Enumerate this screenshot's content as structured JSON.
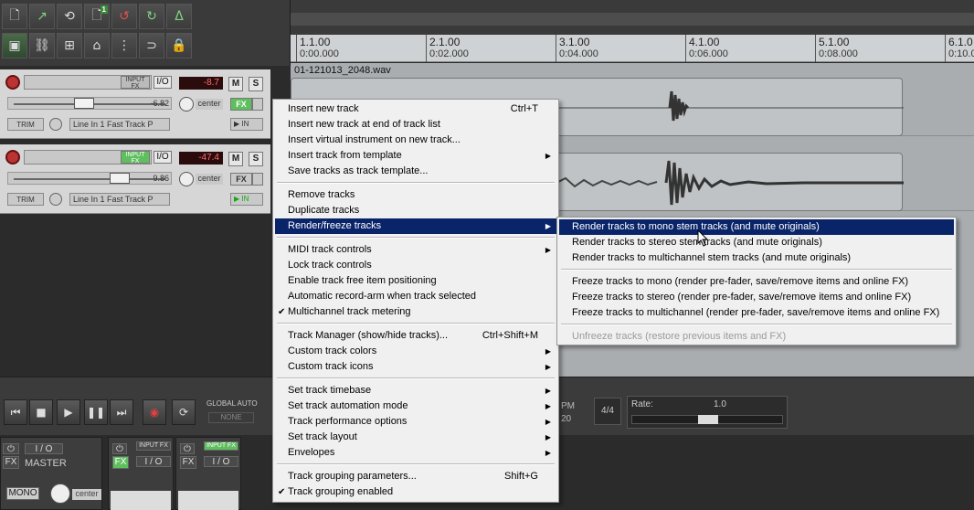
{
  "toolbar": {
    "icons": [
      "new-project-icon",
      "open-project-icon",
      "save-project-icon",
      "project-badge-icon",
      "undo-icon",
      "redo-icon",
      "metronome-icon",
      "grid-snap-icon",
      "ripple-edit-icon",
      "envelope-icon",
      "item-lock-icon",
      "loop-icon",
      "lock-icon"
    ],
    "badge": "1"
  },
  "tracks": [
    {
      "input_fx": "INPUT FX",
      "io": "I/O",
      "volume": "-8.7",
      "mute": "M",
      "solo": "S",
      "fader_value": "-6.82",
      "pan": "center",
      "fx": "FX",
      "trim": "TRIM",
      "rec_input": "Line In 1 Fast Track P",
      "monitor": "IN",
      "fader_fraction": 0.44,
      "fx_active": true,
      "input_fx_active": false,
      "monitor_active": false
    },
    {
      "input_fx": "INPUT FX",
      "io": "I/O",
      "volume": "-47.4",
      "mute": "M",
      "solo": "S",
      "fader_value": "9.86",
      "pan": "center",
      "fx": "FX",
      "trim": "TRIM",
      "rec_input": "Line In 1 Fast Track P",
      "monitor": "IN",
      "fader_fraction": 0.7,
      "fx_active": false,
      "input_fx_active": true,
      "monitor_active": true
    }
  ],
  "ruler": [
    {
      "bar": "1.1.00",
      "time": "0:00.000"
    },
    {
      "bar": "2.1.00",
      "time": "0:02.000"
    },
    {
      "bar": "3.1.00",
      "time": "0:04.000"
    },
    {
      "bar": "4.1.00",
      "time": "0:06.000"
    },
    {
      "bar": "5.1.00",
      "time": "0:08.000"
    },
    {
      "bar": "6.1.0",
      "time": "0:10.0"
    }
  ],
  "item_name": "01-121013_2048.wav",
  "transport": {
    "global_auto": "GLOBAL AUTO",
    "none": "NONE",
    "bpm": "PM",
    "bpm_value": "20",
    "time_sig": "4/4",
    "rate_label": "Rate:",
    "rate_value": "1.0"
  },
  "mixer": {
    "master_label": "MASTER",
    "io": "I / O",
    "fx": "FX",
    "mono": "MONO",
    "pan": "center",
    "input_fx": "INPUT FX"
  },
  "context_menu": {
    "items": [
      {
        "label": "Insert new track",
        "shortcut": "Ctrl+T"
      },
      {
        "label": "Insert new track at end of track list"
      },
      {
        "label": "Insert virtual instrument on new track..."
      },
      {
        "label": "Insert track from template",
        "submenu": true
      },
      {
        "label": "Save tracks as track template..."
      },
      {
        "sep": true
      },
      {
        "label": "Remove tracks"
      },
      {
        "label": "Duplicate tracks"
      },
      {
        "label": "Render/freeze tracks",
        "submenu": true,
        "highlighted": true
      },
      {
        "sep": true
      },
      {
        "label": "MIDI track controls",
        "submenu": true
      },
      {
        "label": "Lock track controls"
      },
      {
        "label": "Enable track free item positioning"
      },
      {
        "label": "Automatic record-arm when track selected"
      },
      {
        "label": "Multichannel track metering",
        "checked": true
      },
      {
        "sep": true
      },
      {
        "label": "Track Manager (show/hide tracks)...",
        "shortcut": "Ctrl+Shift+M"
      },
      {
        "label": "Custom track colors",
        "submenu": true
      },
      {
        "label": "Custom track icons",
        "submenu": true
      },
      {
        "sep": true
      },
      {
        "label": "Set track timebase",
        "submenu": true
      },
      {
        "label": "Set track automation mode",
        "submenu": true
      },
      {
        "label": "Track performance options",
        "submenu": true
      },
      {
        "label": "Set track layout",
        "submenu": true
      },
      {
        "label": "Envelopes",
        "submenu": true
      },
      {
        "sep": true
      },
      {
        "label": "Track grouping parameters...",
        "shortcut": "Shift+G"
      },
      {
        "label": "Track grouping enabled",
        "checked": true
      }
    ]
  },
  "submenu": {
    "items": [
      {
        "label": "Render tracks to mono stem tracks (and mute originals)",
        "highlighted": true
      },
      {
        "label": "Render tracks to stereo stem tracks (and mute originals)"
      },
      {
        "label": "Render tracks to multichannel stem tracks (and mute originals)"
      },
      {
        "sep": true
      },
      {
        "label": "Freeze tracks to mono (render pre-fader, save/remove items and online FX)"
      },
      {
        "label": "Freeze tracks to stereo (render pre-fader, save/remove items and online FX)"
      },
      {
        "label": "Freeze tracks to multichannel (render pre-fader, save/remove items and online FX)"
      },
      {
        "sep": true
      },
      {
        "label": "Unfreeze tracks (restore previous items and FX)",
        "disabled": true
      }
    ]
  }
}
